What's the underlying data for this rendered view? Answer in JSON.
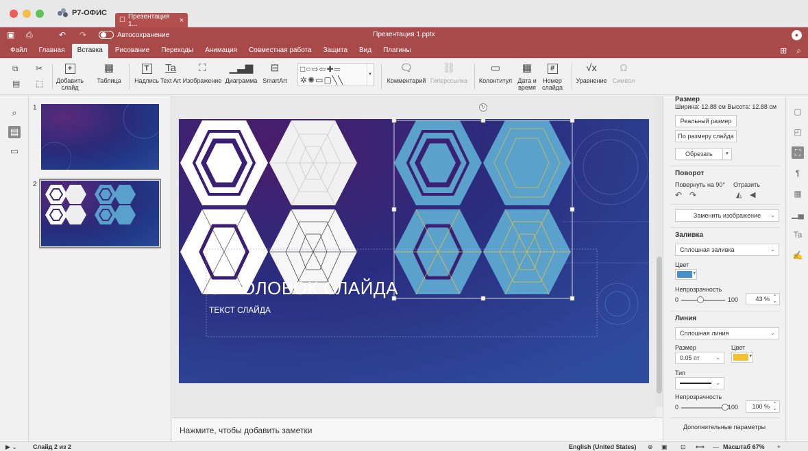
{
  "brand": "Р7-ОФИС",
  "tab": {
    "label": "Презентация 1...",
    "close": "×"
  },
  "titlebar": {
    "autosave": "Автосохранение",
    "doc_title": "Презентация 1.pptx"
  },
  "menu": [
    "Файл",
    "Главная",
    "Вставка",
    "Рисование",
    "Переходы",
    "Анимация",
    "Совместная работа",
    "Защита",
    "Вид",
    "Плагины"
  ],
  "menu_active_index": 2,
  "ribbon": {
    "add_slide": "Добавить слайд",
    "table": "Таблица",
    "textbox": "Надпись",
    "textart": "Text Art",
    "image": "Изображение",
    "chart": "Диаграмма",
    "smartart": "SmartArt",
    "comment": "Комментарий",
    "hyperlink": "Гиперссылка",
    "header_footer": "Колонтитул",
    "datetime": "Дата и время",
    "slide_number": "Номер слайда",
    "equation": "Уравнение",
    "symbol": "Символ"
  },
  "slides": {
    "thumb1_num": "1",
    "thumb2_num": "2"
  },
  "slide": {
    "title": "ЗАГОЛОВОК СЛАЙДА",
    "subtitle": "ТЕКСТ СЛАЙДА"
  },
  "notes_placeholder": "Нажмите, чтобы добавить заметки",
  "panel": {
    "size_h": "Размер",
    "size_values": "Ширина: 12.88 см  Высота: 12.88 см",
    "real_size": "Реальный размер",
    "fit_slide": "По размеру слайда",
    "crop": "Обрезать",
    "rotation_h": "Поворот",
    "rotate90": "Повернуть на 90°",
    "flip": "Отразить",
    "replace_image": "Заменить изображение",
    "fill_h": "Заливка",
    "fill_type": "Сплошная заливка",
    "color_label": "Цвет",
    "fill_color": "#4a90c8",
    "opacity_label": "Непрозрачность",
    "fill_opacity_min": "0",
    "fill_opacity_max": "100",
    "fill_opacity_value": "43 %",
    "fill_opacity_fraction": 0.43,
    "line_h": "Линия",
    "line_type": "Сплошная линия",
    "line_size_label": "Размер",
    "line_color_label": "Цвет",
    "line_size": "0.05 пт",
    "line_color": "#f2c12e",
    "line_style_label": "Тип",
    "line_opacity_label": "Непрозрачность",
    "line_opacity_min": "0",
    "line_opacity_max": "100",
    "line_opacity_value": "100 %",
    "line_opacity_fraction": 1.0,
    "advanced": "Дополнительные параметры"
  },
  "status": {
    "slide_info": "Слайд 2 из 2",
    "language": "English (United States)",
    "zoom": "Масштаб 67%"
  }
}
